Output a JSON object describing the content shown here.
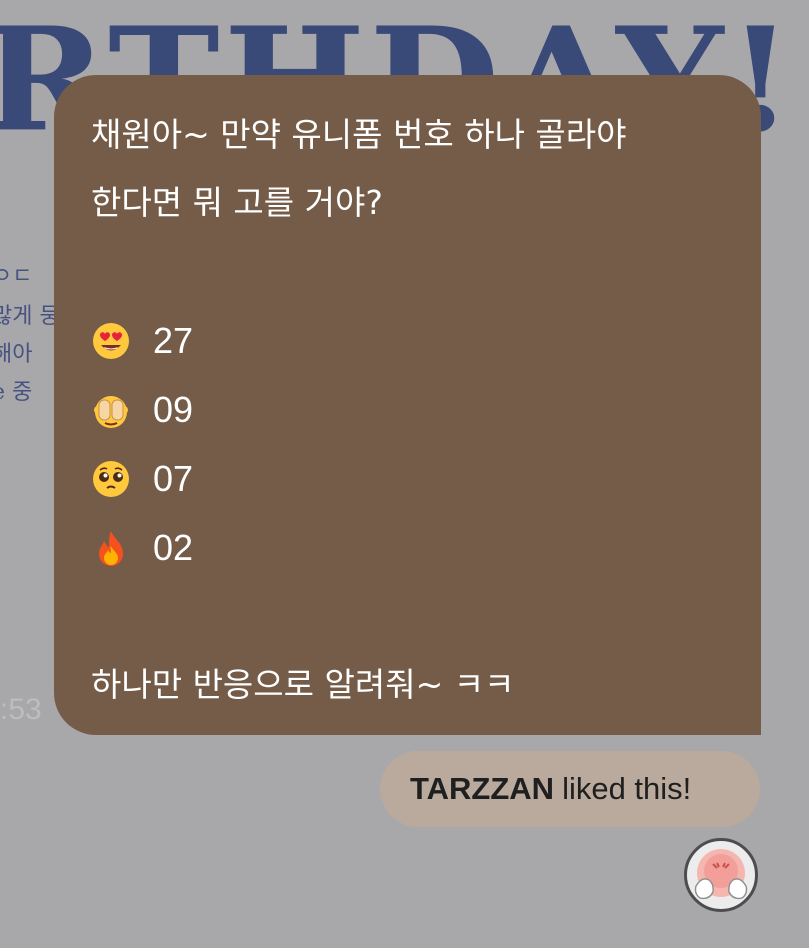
{
  "background": {
    "poster_title": "RTHDAY!",
    "scribble_lines": [
      "ㅇㄷ",
      "많게 둥",
      "해아",
      "e 중"
    ],
    "timestamp": ":53"
  },
  "message": {
    "line1": "채원아~ 만약 유니폼 번호 하나 골라야",
    "line2": "한다면 뭐 고를 거야?",
    "options": [
      {
        "emoji": "heart-eyes-emoji",
        "number": "27"
      },
      {
        "emoji": "see-no-evil-monkey-emoji",
        "number": "09"
      },
      {
        "emoji": "pleading-face-emoji",
        "number": "07"
      },
      {
        "emoji": "fire-emoji",
        "number": "02"
      }
    ],
    "closing": "하나만 반응으로 알려줘~ ㅋㅋ",
    "bubble_color": "#755c49"
  },
  "reaction": {
    "liked_name": "TARZZAN",
    "liked_suffix": "liked this!",
    "pill_color": "#b9aa9d",
    "reaction_icon": "blushing-hands-face-icon"
  }
}
